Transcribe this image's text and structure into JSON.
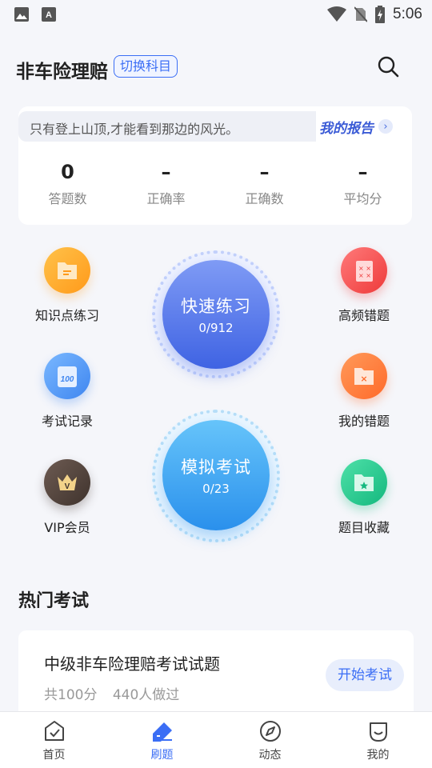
{
  "status_bar": {
    "time": "5:06"
  },
  "header": {
    "title": "非车险理赔",
    "switch_label": "切换科目"
  },
  "stats": {
    "quote": "只有登上山顶,才能看到那边的风光。",
    "report_label": "我的报告",
    "items": [
      {
        "value": "0",
        "label": "答题数"
      },
      {
        "value": "–",
        "label": "正确率"
      },
      {
        "value": "–",
        "label": "正确数"
      },
      {
        "value": "–",
        "label": "平均分"
      }
    ]
  },
  "functions": {
    "knowledge": "知识点练习",
    "records": "考试记录",
    "vip": "VIP会员",
    "frequent_errors": "高频错题",
    "my_errors": "我的错题",
    "favorites": "题目收藏"
  },
  "quick_practice": {
    "title": "快速练习",
    "count": "0/912"
  },
  "mock_exam": {
    "title": "模拟考试",
    "count": "0/23"
  },
  "hot_exams": {
    "title": "热门考试",
    "items": [
      {
        "name": "中级非车险理赔考试试题",
        "score": "共100分",
        "takers": "440人做过",
        "action": "开始考试"
      }
    ]
  },
  "tabs": [
    {
      "label": "首页"
    },
    {
      "label": "刷题"
    },
    {
      "label": "动态"
    },
    {
      "label": "我的"
    }
  ],
  "colors": {
    "accent": "#3b6ef5"
  }
}
